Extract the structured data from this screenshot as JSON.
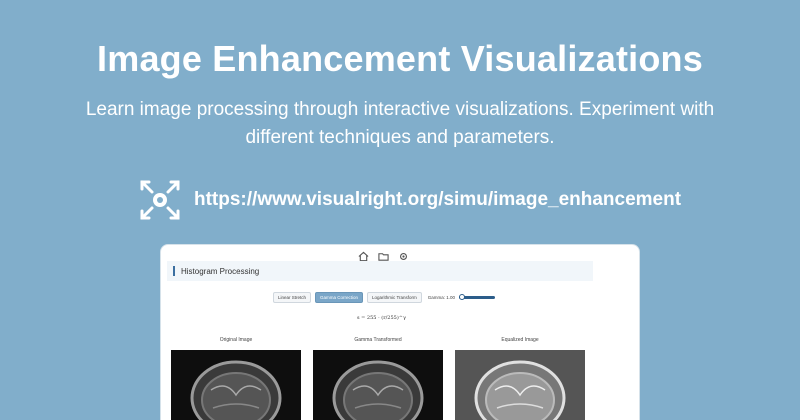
{
  "page": {
    "title": "Image Enhancement Visualizations",
    "subtitle": "Learn image processing through interactive visualizations. Experiment with different techniques and parameters.",
    "url": "https://www.visualright.org/simu/image_enhancement",
    "colors": {
      "background": "#81aecb",
      "text": "#ffffff"
    },
    "logo_icon": "expand-arrows-eye-icon"
  },
  "app": {
    "toolbar": {
      "icons": [
        "home-icon",
        "folder-icon",
        "settings-icon"
      ]
    },
    "panel_title": "Histogram Processing",
    "controls": {
      "buttons": [
        {
          "label": "Linear Stretch",
          "active": false
        },
        {
          "label": "Gamma Correction",
          "active": true
        },
        {
          "label": "Logarithmic Transform",
          "active": false
        }
      ],
      "gamma_label": "Gamma: 1.00",
      "gamma_value": 1.0
    },
    "formula": "s = 255 · (r/255)^γ",
    "images": [
      {
        "label": "Original Image"
      },
      {
        "label": "Gamma Transformed"
      },
      {
        "label": "Equalized Image"
      }
    ]
  }
}
